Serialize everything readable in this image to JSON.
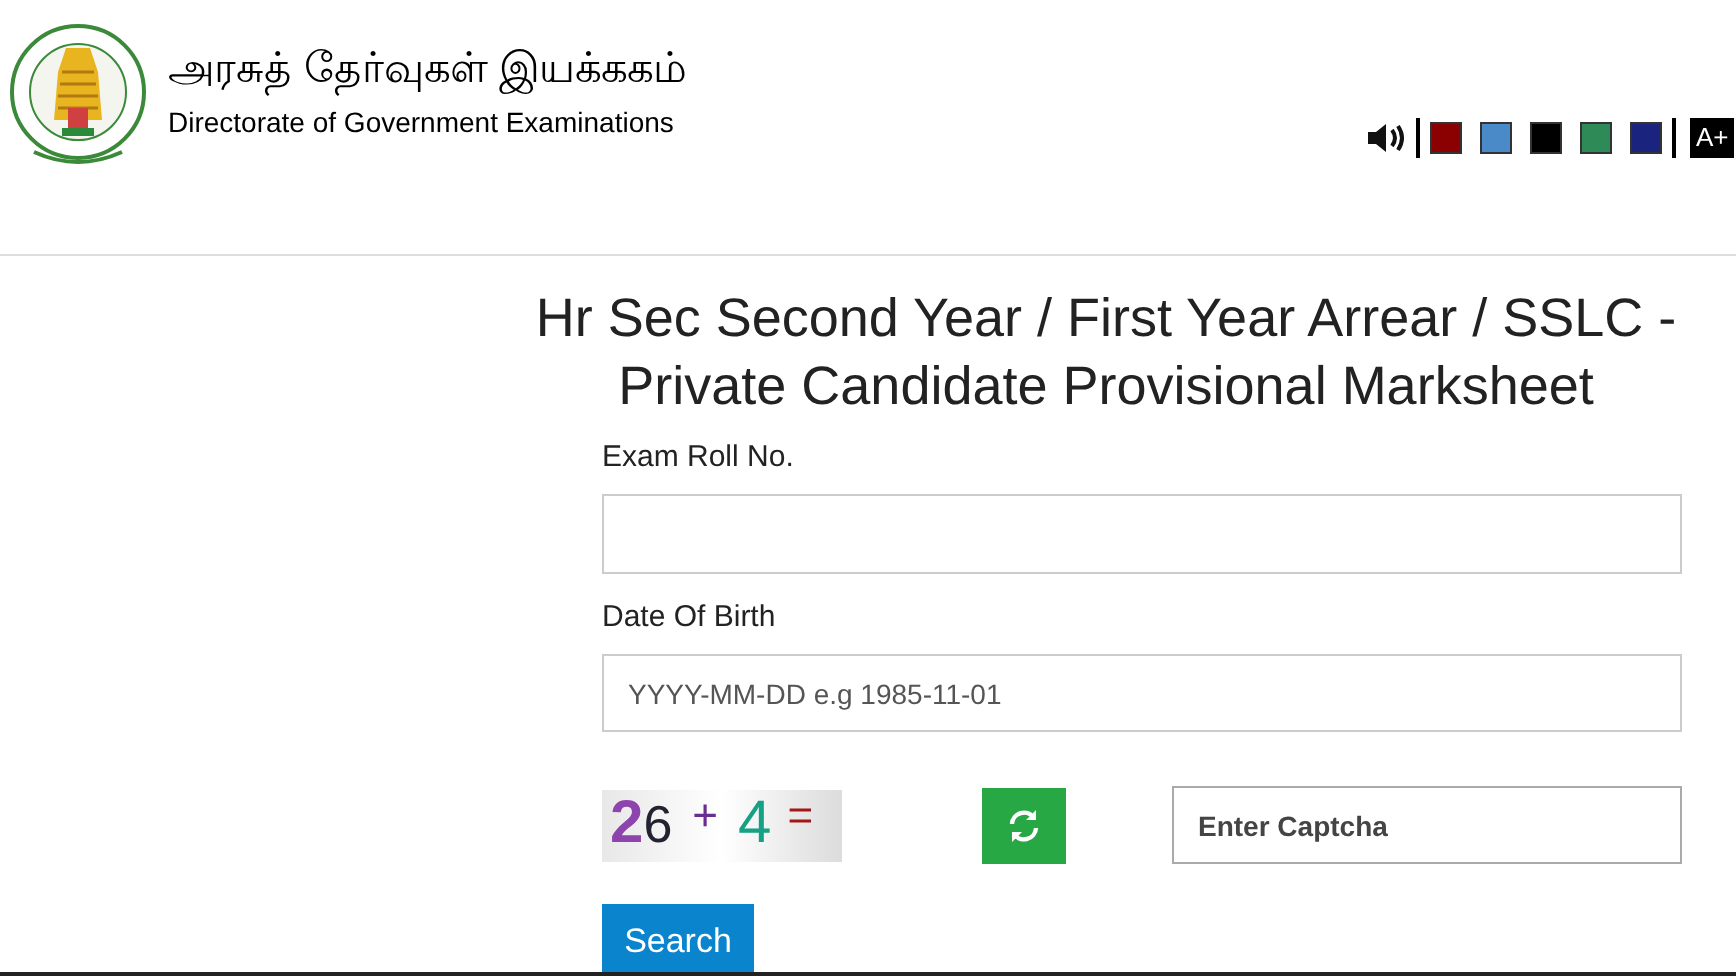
{
  "header": {
    "title_tamil": "அரசுத் தேர்வுகள் இயக்ககம்",
    "title_english": "Directorate of Government Examinations"
  },
  "toolbar": {
    "themes": [
      {
        "color": "#8b0000"
      },
      {
        "color": "#4a8ac9"
      },
      {
        "color": "#000000"
      },
      {
        "color": "#2e8b57"
      },
      {
        "color": "#1a237e"
      }
    ],
    "font_button": "A+"
  },
  "page_title": "Hr Sec Second Year / First Year Arrear / SSLC - Private Candidate Provisional Marksheet",
  "form": {
    "roll_label": "Exam Roll No.",
    "dob_label": "Date Of Birth",
    "dob_placeholder": "YYYY-MM-DD e.g 1985-11-01",
    "captcha": [
      {
        "text": "2",
        "color": "#8e44ad"
      },
      {
        "text": "6",
        "color": "#222233"
      },
      {
        "text": "+",
        "color": "#6a2c91"
      },
      {
        "text": "4",
        "color": "#16a085"
      },
      {
        "text": "=",
        "color": "#a01818"
      }
    ],
    "captcha_placeholder": "Enter Captcha",
    "search_button": "Search"
  }
}
